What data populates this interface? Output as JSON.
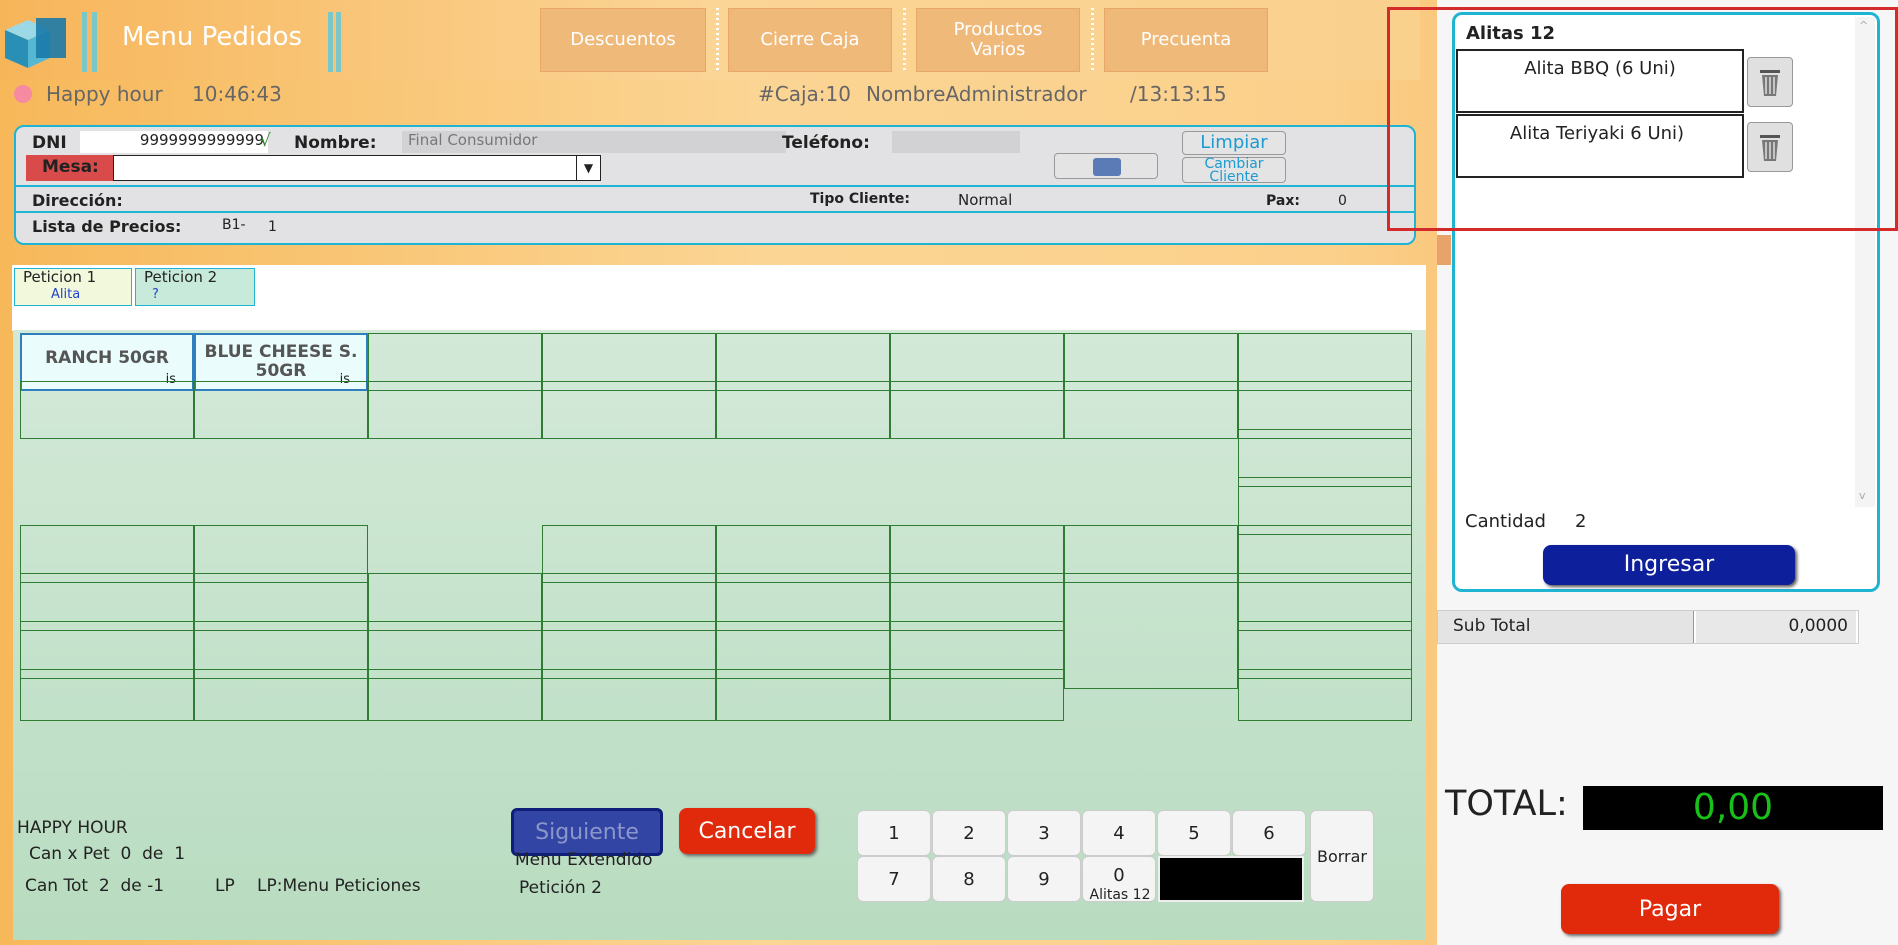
{
  "header": {
    "title": "Menu Pedidos",
    "buttons": [
      "Descuentos",
      "Cierre Caja",
      "Productos Varios",
      "Precuenta"
    ]
  },
  "status": {
    "mode": "Happy hour",
    "time": "10:46:43",
    "caja": "#Caja:10",
    "user": "NombreAdministrador",
    "time2": "/13:13:15"
  },
  "client": {
    "dni_label": "DNI",
    "dni": "9999999999999",
    "check": "√",
    "nombre_label": "Nombre:",
    "nombre": "Final Consumidor",
    "telefono_label": "Teléfono:",
    "mesa_label": "Mesa:",
    "limpiar": "Limpiar",
    "cambiar": "Cambiar Cliente",
    "direccion_label": "Dirección:",
    "tipo_label": "Tipo Cliente:",
    "tipo": "Normal",
    "pax_label": "Pax:",
    "pax": "0",
    "lista_label": "Lista de Precios:",
    "lista_code": "B1-",
    "lista_num": "1"
  },
  "tabs": [
    {
      "title": "Peticion 1",
      "sub": "Alita"
    },
    {
      "title": "Peticion 2",
      "sub": "?"
    }
  ],
  "products": [
    {
      "name": "RANCH 50GR",
      "tag": "is"
    },
    {
      "name": "BLUE CHEESE S. 50GR",
      "tag": "is"
    }
  ],
  "footer": {
    "happy": "HAPPY HOUR",
    "can_pet": "Can x Pet  0  de  1",
    "can_tot": "Can Tot  2  de -1",
    "lp": "LP",
    "lp_menu": "LP:Menu Peticiones",
    "siguiente": "Siguiente",
    "cancelar": "Cancelar",
    "menu_ext": "Menu Extendido",
    "peticion": "Petición 2",
    "keys": [
      "1",
      "2",
      "3",
      "4",
      "5",
      "6",
      "7",
      "8",
      "9",
      "0"
    ],
    "key0_sub": "Alitas 12",
    "borrar": "Borrar"
  },
  "order": {
    "title": "Alitas 12",
    "items": [
      "Alita BBQ (6 Uni)",
      "Alita Teriyaki 6 Uni)"
    ],
    "cantidad_label": "Cantidad",
    "cantidad": "2",
    "ingresar": "Ingresar"
  },
  "totals": {
    "subtotal_label": "Sub Total",
    "subtotal": "0,0000",
    "total_label": "TOTAL:",
    "total": "0,00",
    "pagar": "Pagar"
  },
  "colors": {
    "accent": "#1fb5d2",
    "grid_border": "#2e7d32",
    "ingresar": "#0d1f9b",
    "red": "#e02a0b",
    "total": "#19c019"
  }
}
